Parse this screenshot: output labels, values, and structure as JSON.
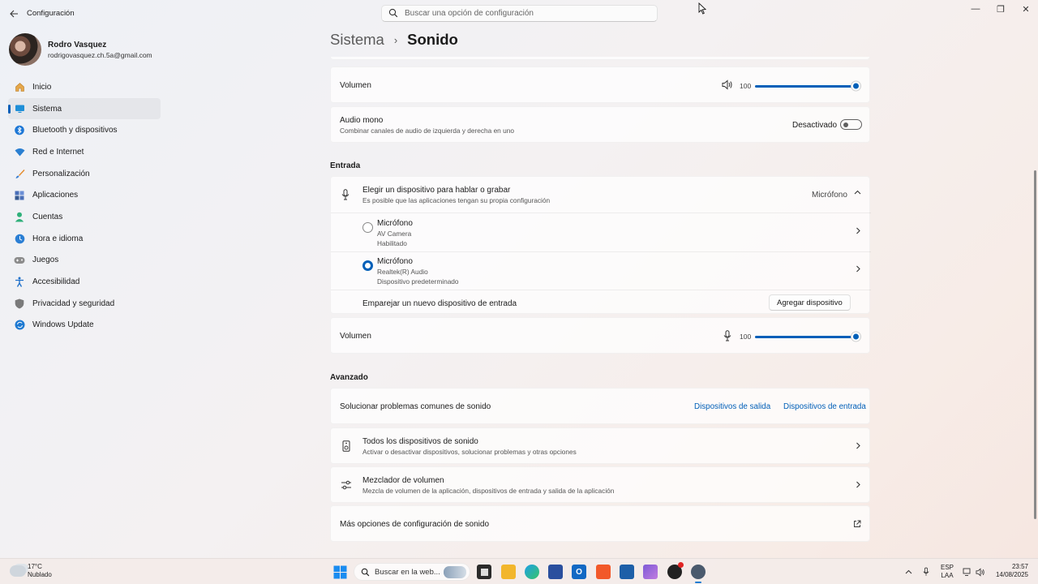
{
  "window": {
    "title": "Configuración",
    "search_placeholder": "Buscar una opción de configuración",
    "minimize": "—",
    "maximize": "❐",
    "close": "✕"
  },
  "profile": {
    "name": "Rodro Vasquez",
    "email": "rodrigovasquez.ch.5a@gmail.com"
  },
  "nav": {
    "items": [
      {
        "label": "Inicio",
        "icon": "home-icon"
      },
      {
        "label": "Sistema",
        "icon": "monitor-icon",
        "active": true
      },
      {
        "label": "Bluetooth y dispositivos",
        "icon": "bluetooth-icon"
      },
      {
        "label": "Red e Internet",
        "icon": "wifi-icon"
      },
      {
        "label": "Personalización",
        "icon": "brush-icon"
      },
      {
        "label": "Aplicaciones",
        "icon": "apps-icon"
      },
      {
        "label": "Cuentas",
        "icon": "person-icon"
      },
      {
        "label": "Hora e idioma",
        "icon": "globe-clock-icon"
      },
      {
        "label": "Juegos",
        "icon": "gamepad-icon"
      },
      {
        "label": "Accesibilidad",
        "icon": "accessibility-icon"
      },
      {
        "label": "Privacidad y seguridad",
        "icon": "shield-icon"
      },
      {
        "label": "Windows Update",
        "icon": "update-icon"
      }
    ]
  },
  "breadcrumb": {
    "parent": "Sistema",
    "separator": "›",
    "current": "Sonido"
  },
  "output": {
    "volume_label": "Volumen",
    "volume_value": "100",
    "volume_level": 1.0,
    "mono_title": "Audio mono",
    "mono_sub": "Combinar canales de audio de izquierda y derecha en uno",
    "mono_state": "Desactivado"
  },
  "input": {
    "section_title": "Entrada",
    "choose_title": "Elegir un dispositivo para hablar o grabar",
    "choose_sub": "Es posible que las aplicaciones tengan su propia configuración",
    "selected_device": "Micrófono",
    "devices": [
      {
        "name": "Micrófono",
        "detail": "AV Camera",
        "status": "Habilitado",
        "selected": false
      },
      {
        "name": "Micrófono",
        "detail": "Realtek(R) Audio",
        "status": "Dispositivo predeterminado",
        "selected": true
      }
    ],
    "pair_label": "Emparejar un nuevo dispositivo de entrada",
    "add_button": "Agregar dispositivo",
    "volume_label": "Volumen",
    "volume_value": "100",
    "volume_level": 1.0
  },
  "advanced": {
    "section_title": "Avanzado",
    "troubleshoot_label": "Solucionar problemas comunes de sonido",
    "output_link": "Dispositivos de salida",
    "input_link": "Dispositivos de entrada",
    "all_devices_title": "Todos los dispositivos de sonido",
    "all_devices_sub": "Activar o desactivar dispositivos, solucionar problemas y otras opciones",
    "mixer_title": "Mezclador de volumen",
    "mixer_sub": "Mezcla de volumen de la aplicación, dispositivos de entrada y salida de la aplicación",
    "more_options": "Más opciones de configuración de sonido"
  },
  "taskbar": {
    "temperature": "17°C",
    "weather": "Nublado",
    "search_label": "Buscar en la web...",
    "lang_top": "ESP",
    "lang_bottom": "LAA",
    "time": "23:57",
    "date": "14/08/2025"
  },
  "colors": {
    "accent": "#005fb8"
  }
}
